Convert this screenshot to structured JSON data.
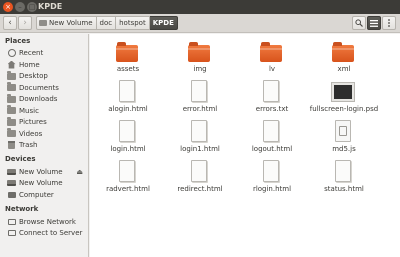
{
  "window": {
    "title": "KPDE"
  },
  "breadcrumb": [
    "New Volume",
    "doc",
    "hotspot",
    "KPDE"
  ],
  "sidebar": {
    "places_heading": "Places",
    "places": [
      {
        "label": "Recent",
        "icon": "clock-icon"
      },
      {
        "label": "Home",
        "icon": "home-icon"
      },
      {
        "label": "Desktop",
        "icon": "folder-icon"
      },
      {
        "label": "Documents",
        "icon": "folder-icon"
      },
      {
        "label": "Downloads",
        "icon": "folder-icon"
      },
      {
        "label": "Music",
        "icon": "folder-icon"
      },
      {
        "label": "Pictures",
        "icon": "folder-icon"
      },
      {
        "label": "Videos",
        "icon": "folder-icon"
      },
      {
        "label": "Trash",
        "icon": "trash-icon"
      }
    ],
    "devices_heading": "Devices",
    "devices": [
      {
        "label": "New Volume",
        "icon": "drive-icon"
      },
      {
        "label": "New Volume",
        "icon": "drive-icon"
      },
      {
        "label": "Computer",
        "icon": "computer-icon"
      }
    ],
    "network_heading": "Network",
    "network": [
      {
        "label": "Browse Network",
        "icon": "network-icon"
      },
      {
        "label": "Connect to Server",
        "icon": "network-icon"
      }
    ]
  },
  "files": [
    {
      "name": "assets",
      "type": "folder"
    },
    {
      "name": "img",
      "type": "folder"
    },
    {
      "name": "lv",
      "type": "folder"
    },
    {
      "name": "xml",
      "type": "folder"
    },
    {
      "name": "alogin.html",
      "type": "html"
    },
    {
      "name": "error.html",
      "type": "html"
    },
    {
      "name": "errors.txt",
      "type": "text"
    },
    {
      "name": "fullscreen-login.psd",
      "type": "image"
    },
    {
      "name": "login.html",
      "type": "html"
    },
    {
      "name": "login1.html",
      "type": "html"
    },
    {
      "name": "logout.html",
      "type": "html"
    },
    {
      "name": "md5.js",
      "type": "script"
    },
    {
      "name": "radvert.html",
      "type": "html"
    },
    {
      "name": "redirect.html",
      "type": "html"
    },
    {
      "name": "rlogin.html",
      "type": "html"
    },
    {
      "name": "status.html",
      "type": "html"
    }
  ],
  "colors": {
    "accent": "#e95420",
    "titlebar": "#3c3b37",
    "folder": "#e2652a"
  }
}
